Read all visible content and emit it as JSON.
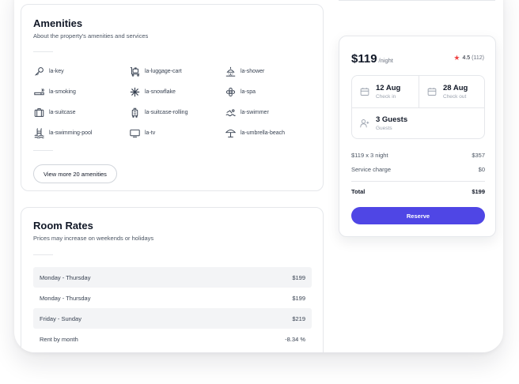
{
  "amenities": {
    "title": "Amenities",
    "subtitle": "About the property's amenities and services",
    "rows": [
      [
        {
          "icon": "key-icon",
          "label": "la-key"
        },
        {
          "icon": "luggage-cart-icon",
          "label": "la-luggage-cart"
        },
        {
          "icon": "shower-icon",
          "label": "la-shower"
        }
      ],
      [
        {
          "icon": "smoking-icon",
          "label": "la-smoking"
        },
        {
          "icon": "snowflake-icon",
          "label": "la-snowflake"
        },
        {
          "icon": "spa-icon",
          "label": "la-spa"
        }
      ],
      [
        {
          "icon": "suitcase-icon",
          "label": "la-suitcase"
        },
        {
          "icon": "suitcase-rolling-icon",
          "label": "la-suitcase-rolling"
        },
        {
          "icon": "swimmer-icon",
          "label": "la-swimmer"
        }
      ],
      [
        {
          "icon": "swimming-pool-icon",
          "label": "la-swimming-pool"
        },
        {
          "icon": "tv-icon",
          "label": "la-tv"
        },
        {
          "icon": "umbrella-beach-icon",
          "label": "la-umbrella-beach"
        }
      ]
    ],
    "more_label": "View more 20 amenities"
  },
  "rates": {
    "title": "Room Rates",
    "subtitle": "Prices may increase on weekends or holidays",
    "rows": [
      {
        "period": "Monday - Thursday",
        "price": "$199"
      },
      {
        "period": "Monday - Thursday",
        "price": "$199"
      },
      {
        "period": "Friday - Sunday",
        "price": "$219"
      },
      {
        "period": "Rent by month",
        "price": "-8.34 %"
      }
    ]
  },
  "booking": {
    "price": "$119",
    "per": "/night",
    "rating": "4.5",
    "rating_count": "(112)",
    "checkin": {
      "value": "12 Aug",
      "label": "Check in"
    },
    "checkout": {
      "value": "28 Aug",
      "label": "Check out"
    },
    "guests": {
      "value": "3 Guests",
      "label": "Guests"
    },
    "lines": [
      {
        "label": "$119 x 3 night",
        "value": "$357"
      },
      {
        "label": "Service charge",
        "value": "$0"
      }
    ],
    "total_label": "Total",
    "total_value": "$199",
    "reserve_label": "Reserve"
  },
  "colors": {
    "accent": "#4f46e5",
    "star": "#ef4444"
  }
}
